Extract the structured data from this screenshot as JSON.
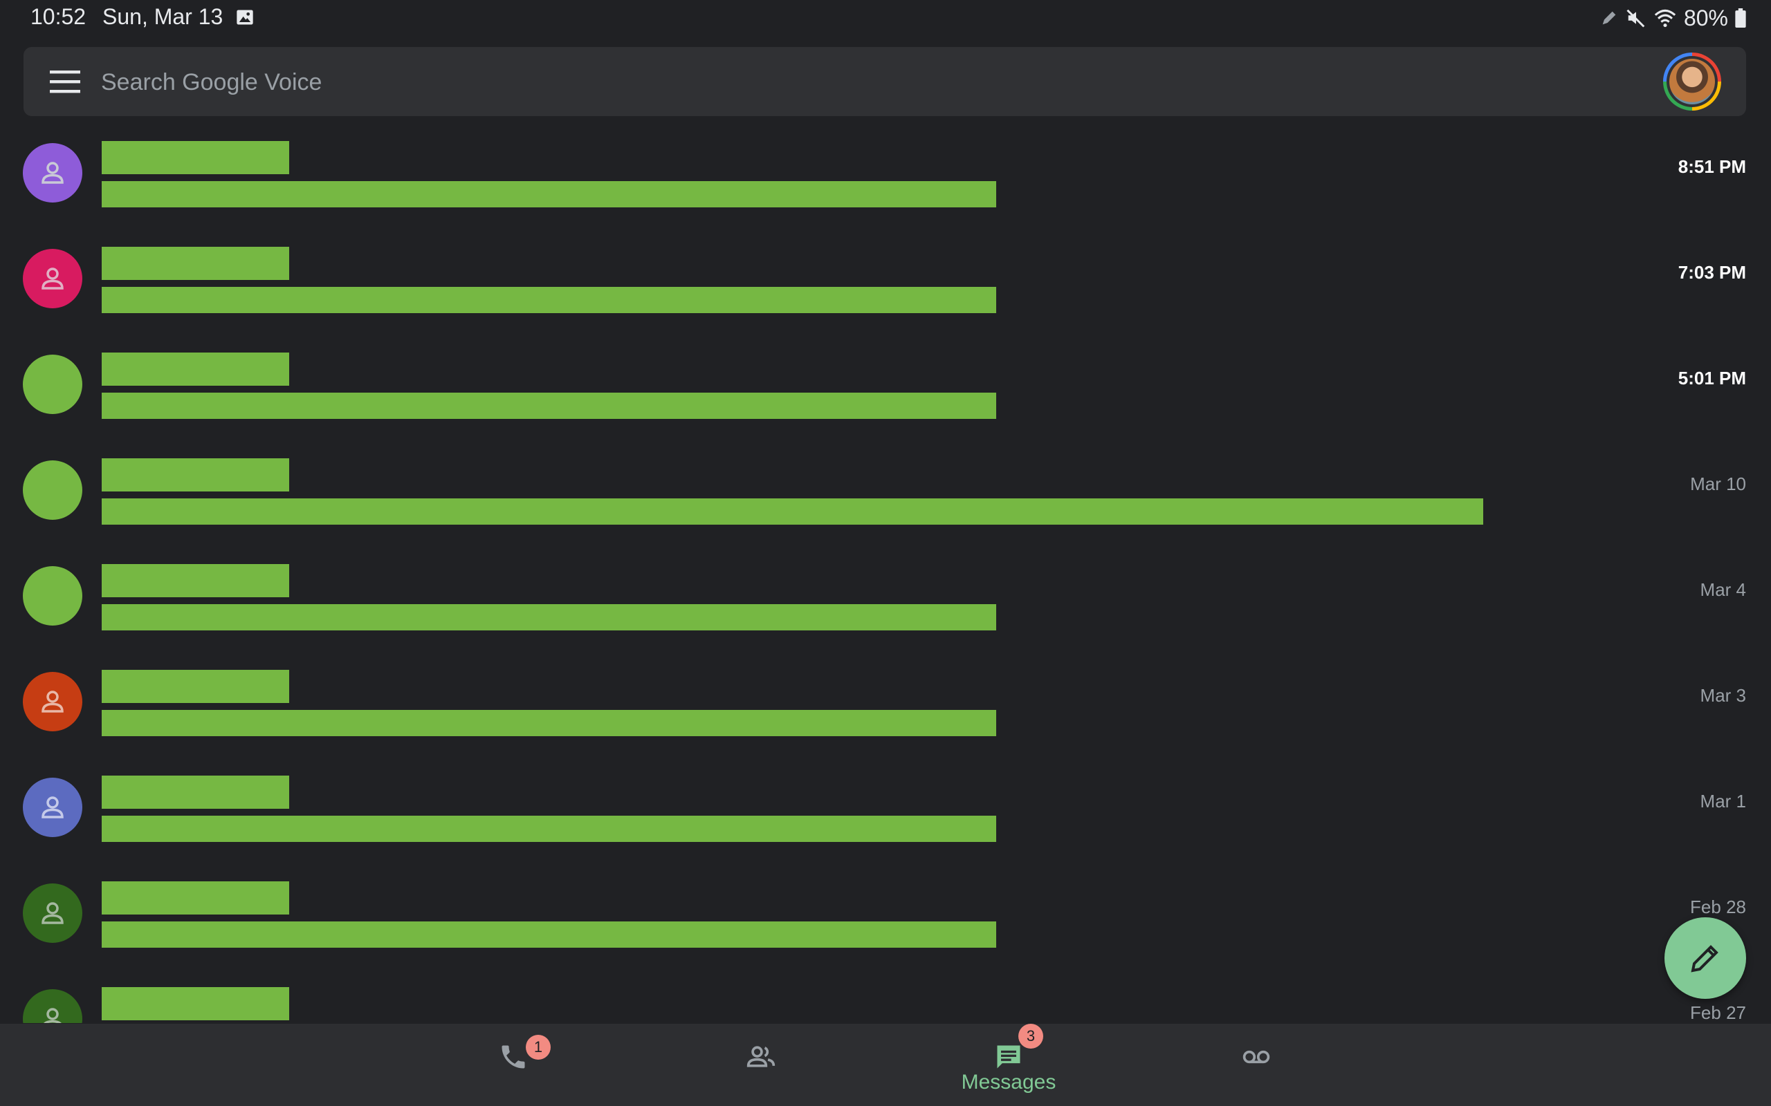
{
  "status_bar": {
    "time": "10:52",
    "date": "Sun, Mar 13",
    "battery": "80%",
    "icons": [
      "gallery-icon",
      "pen-icon",
      "mute-icon",
      "wifi-icon",
      "battery-icon"
    ]
  },
  "search": {
    "placeholder": "Search Google Voice"
  },
  "conversations": [
    {
      "name": "",
      "snippet": "",
      "time": "8:51 PM",
      "unread": true,
      "avatar_color": "#8e5cd9",
      "avatar_icon": "person-icon"
    },
    {
      "name": "",
      "snippet": "",
      "time": "7:03 PM",
      "unread": true,
      "avatar_color": "#d81b60",
      "avatar_icon": "person-icon"
    },
    {
      "name": "",
      "snippet": "",
      "time": "5:01 PM",
      "unread": true,
      "avatar_color": "#76b843",
      "avatar_icon": "none"
    },
    {
      "name": "",
      "snippet": "",
      "time": "Mar 10",
      "unread": false,
      "avatar_color": "#76b843",
      "avatar_icon": "none"
    },
    {
      "name": "",
      "snippet": "",
      "time": "Mar 4",
      "unread": false,
      "avatar_color": "#76b843",
      "avatar_icon": "none"
    },
    {
      "name": "",
      "snippet": "",
      "time": "Mar 3",
      "unread": false,
      "avatar_color": "#c63d13",
      "avatar_icon": "person-icon"
    },
    {
      "name": "",
      "snippet": "",
      "time": "Mar 1",
      "unread": false,
      "avatar_color": "#5c6bc0",
      "avatar_icon": "person-icon"
    },
    {
      "name": "",
      "snippet": "",
      "time": "Feb 28",
      "unread": false,
      "avatar_color": "#33691e",
      "avatar_icon": "person-icon"
    },
    {
      "name": "",
      "snippet": "",
      "time": "Feb 27",
      "unread": false,
      "avatar_color": "#33691e",
      "avatar_icon": "person-icon"
    }
  ],
  "fab": {
    "icon": "pencil-icon"
  },
  "bottom_nav": {
    "tabs": [
      {
        "id": "calls",
        "icon": "phone-icon",
        "badge": "1",
        "label": ""
      },
      {
        "id": "contacts",
        "icon": "contacts-icon",
        "badge": "",
        "label": ""
      },
      {
        "id": "messages",
        "icon": "messages-icon",
        "badge": "3",
        "label": "Messages",
        "active": true
      },
      {
        "id": "voicemail",
        "icon": "voicemail-icon",
        "badge": "",
        "label": ""
      }
    ]
  },
  "colors": {
    "background": "#202124",
    "search_bar": "#303134",
    "accent": "#81c995",
    "badge": "#f28b82",
    "redaction": "#76b843"
  }
}
